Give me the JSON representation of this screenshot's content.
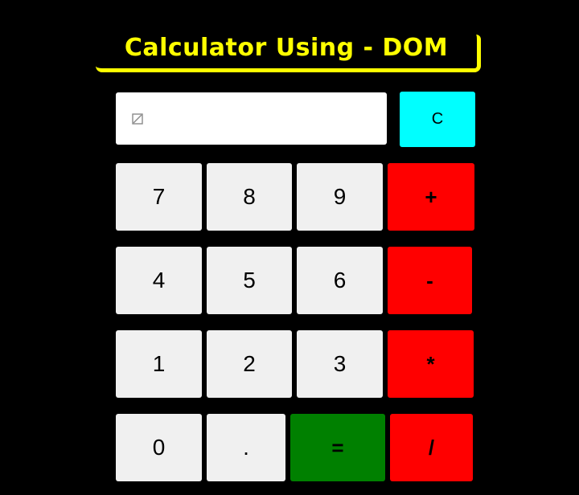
{
  "title": "Calculator Using - DOM",
  "display": {
    "value": "",
    "icon": "broken-image-icon"
  },
  "buttons": {
    "clear": "C",
    "seven": "7",
    "eight": "8",
    "nine": "9",
    "plus": "+",
    "four": "4",
    "five": "5",
    "six": "6",
    "minus": "-",
    "one": "1",
    "two": "2",
    "three": "3",
    "multiply": "*",
    "zero": "0",
    "dot": ".",
    "equals": "=",
    "divide": "/"
  },
  "colors": {
    "title": "#ffff00",
    "background": "#000000",
    "number_button": "#f0f0f0",
    "operator_button": "#ff0000",
    "equals_button": "#008000",
    "clear_button": "#00ffff"
  }
}
